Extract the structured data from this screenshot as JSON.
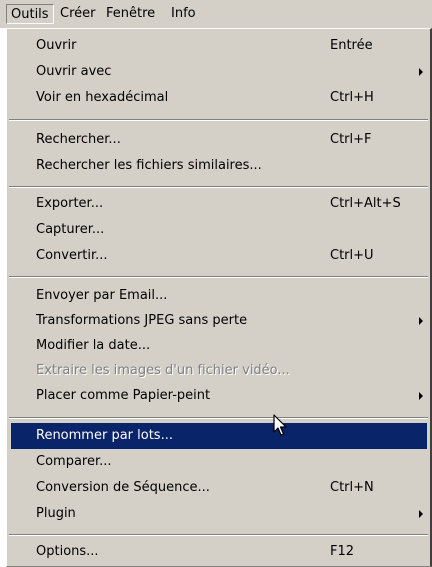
{
  "menubar": {
    "items": [
      "Outils",
      "Créer",
      "Fenêtre",
      "Info"
    ],
    "active_index": 0
  },
  "menu": {
    "ouvrir": {
      "label": "Ouvrir",
      "shortcut": "Entrée"
    },
    "ouvrir_avec": {
      "label": "Ouvrir avec",
      "has_submenu": true
    },
    "voir_hex": {
      "label": "Voir en hexadécimal",
      "shortcut": "Ctrl+H"
    },
    "rechercher": {
      "label": "Rechercher...",
      "shortcut": "Ctrl+F"
    },
    "rechercher_similaires": {
      "label": "Rechercher les fichiers similaires..."
    },
    "exporter": {
      "label": "Exporter...",
      "shortcut": "Ctrl+Alt+S"
    },
    "capturer": {
      "label": "Capturer..."
    },
    "convertir": {
      "label": "Convertir...",
      "shortcut": "Ctrl+U"
    },
    "envoyer_email": {
      "label": "Envoyer par Email..."
    },
    "transformations_jpeg": {
      "label": "Transformations JPEG sans perte",
      "has_submenu": true
    },
    "modifier_date": {
      "label": "Modifier la date..."
    },
    "extraire_images": {
      "label": "Extraire les images d'un fichier vidéo...",
      "disabled": true
    },
    "papier_peint": {
      "label": "Placer comme Papier-peint",
      "has_submenu": true
    },
    "renommer_lots": {
      "label": "Renommer par lots...",
      "highlighted": true
    },
    "comparer": {
      "label": "Comparer..."
    },
    "conversion_sequence": {
      "label": "Conversion de Séquence...",
      "shortcut": "Ctrl+N"
    },
    "plugin": {
      "label": "Plugin",
      "has_submenu": true
    },
    "options": {
      "label": "Options...",
      "shortcut": "F12"
    }
  },
  "colors": {
    "menu_background": "#d4d0c8",
    "highlight_background": "#0a246a",
    "highlight_text": "#ffffff",
    "disabled_text": "#808080"
  },
  "icons": {
    "cursor": "mouse-pointer-icon",
    "submenu": "submenu-arrow-icon"
  }
}
